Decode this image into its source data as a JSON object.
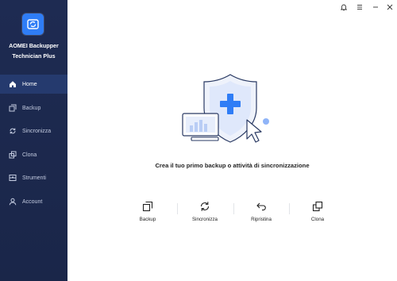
{
  "app": {
    "name_line1": "AOMEI Backupper",
    "name_line2": "Technician Plus"
  },
  "sidebar": {
    "items": [
      {
        "label": "Home",
        "icon": "home-icon",
        "active": true
      },
      {
        "label": "Backup",
        "icon": "backup-icon",
        "active": false
      },
      {
        "label": "Sincronizza",
        "icon": "sync-icon",
        "active": false
      },
      {
        "label": "Clona",
        "icon": "clone-icon",
        "active": false
      },
      {
        "label": "Strumenti",
        "icon": "tools-icon",
        "active": false
      },
      {
        "label": "Account",
        "icon": "account-icon",
        "active": false
      }
    ]
  },
  "main": {
    "headline": "Crea il tuo primo backup o attività di sincronizzazione",
    "actions": [
      {
        "label": "Backup",
        "icon": "backup-icon"
      },
      {
        "label": "Sincronizza",
        "icon": "sync-icon"
      },
      {
        "label": "Ripristina",
        "icon": "restore-icon"
      },
      {
        "label": "Clona",
        "icon": "clone-icon"
      }
    ]
  },
  "colors": {
    "sidebar_bg": "#1e2b52",
    "sidebar_active": "#253a6e",
    "accent": "#2f7df6"
  }
}
